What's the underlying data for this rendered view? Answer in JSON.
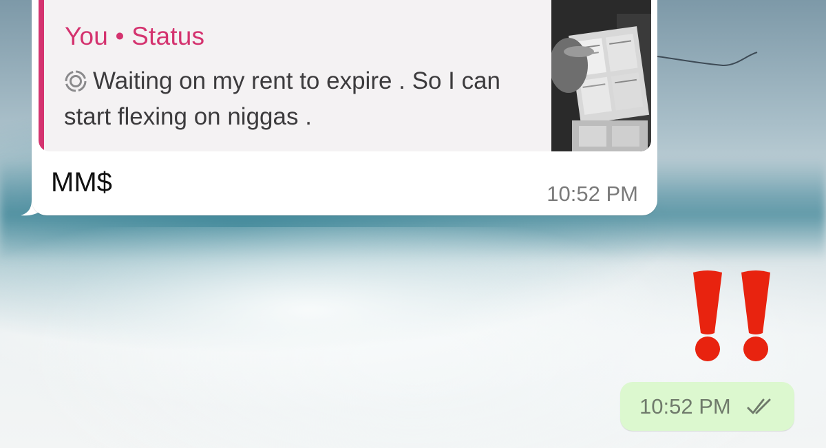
{
  "incoming_message": {
    "quote": {
      "author": "You • Status",
      "text": "Waiting on my rent to expire . So I can start flexing on niggas .",
      "status_icon": "status-ring-icon",
      "accent_color": "#d4336f"
    },
    "text": "MM$",
    "time": "10:52 PM"
  },
  "reaction": {
    "icon": "double-exclamation-emoji",
    "color": "#e8230f"
  },
  "outgoing_message": {
    "time": "10:52 PM",
    "status_icon": "double-check-read-icon",
    "bubble_color": "#dcf8cf"
  }
}
